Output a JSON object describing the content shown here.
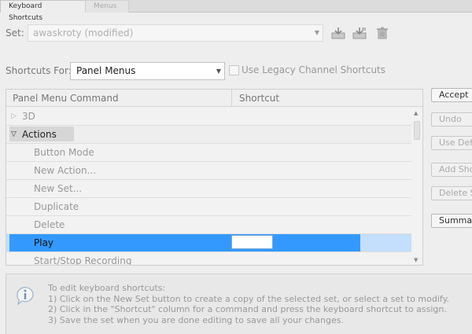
{
  "tabs": [
    {
      "label": "Keyboard Shortcuts",
      "active": true
    },
    {
      "label": "Menus",
      "active": false
    }
  ],
  "set": {
    "label": "Set:",
    "value": "awaskroty (modified)"
  },
  "toolbar_icons": [
    "save-set-icon",
    "save-set-as-icon",
    "delete-set-icon"
  ],
  "shortcuts_for": {
    "label": "Shortcuts For:",
    "value": "Panel Menus"
  },
  "legacy": {
    "label": "Use Legacy Channel Shortcuts",
    "checked": false
  },
  "table": {
    "headers": {
      "command": "Panel Menu Command",
      "shortcut": "Shortcut"
    },
    "rows": [
      {
        "type": "group",
        "label": "3D",
        "expanded": false
      },
      {
        "type": "group",
        "label": "Actions",
        "expanded": true
      },
      {
        "type": "item",
        "label": "Button Mode"
      },
      {
        "type": "item",
        "label": "New Action..."
      },
      {
        "type": "item",
        "label": "New Set..."
      },
      {
        "type": "item",
        "label": "Duplicate"
      },
      {
        "type": "item",
        "label": "Delete"
      },
      {
        "type": "item",
        "label": "Play",
        "selected": true,
        "shortcut": ""
      },
      {
        "type": "item",
        "label": "Start/Stop Recording"
      }
    ]
  },
  "buttons": {
    "accept": "Accept",
    "undo": "Undo",
    "use_default": "Use Default",
    "add_shortcut": "Add Shortcut",
    "delete_shortcut": "Delete Shortcut",
    "summarize": "Summarize"
  },
  "info": {
    "lines": [
      "To edit keyboard shortcuts:",
      "1) Click on the New Set button to create a copy of the selected set, or select a set to modify.",
      "2) Click in the \"Shortcut\" column for a command and press the keyboard shortcut to assign.",
      "3) Save the set when you are done editing to save all your changes."
    ]
  },
  "colors": {
    "selection": "#3399ff",
    "selection_row": "#c3dffc",
    "background": "#eeeeee"
  }
}
